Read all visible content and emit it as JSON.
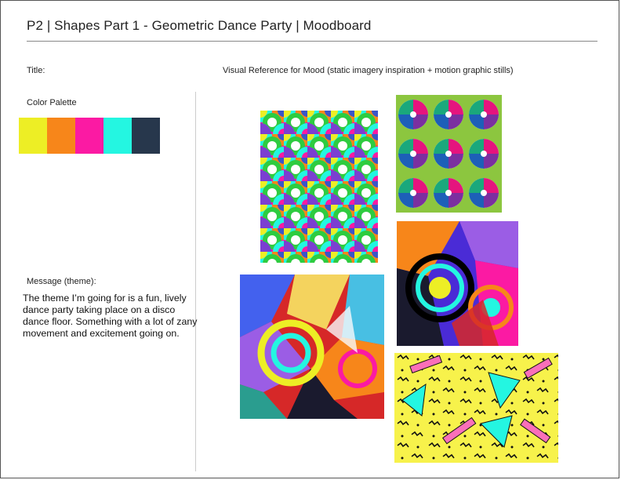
{
  "header": {
    "title": "P2 | Shapes Part 1 - Geometric Dance Party | Moodboard"
  },
  "labels": {
    "title_label": "Title:",
    "palette_label": "Color Palette",
    "visual_ref": "Visual Reference for Mood (static imagery inspiration + motion graphic stills)",
    "message_label": "Message (theme):"
  },
  "palette": [
    "#EDEE25",
    "#F7861A",
    "#FB1AA3",
    "#24F6E1",
    "#27374C"
  ],
  "message": "The theme I’m going for is a fun, lively dance party taking place on a disco dance floor. Something with a lot of zany movement and excitement going on."
}
